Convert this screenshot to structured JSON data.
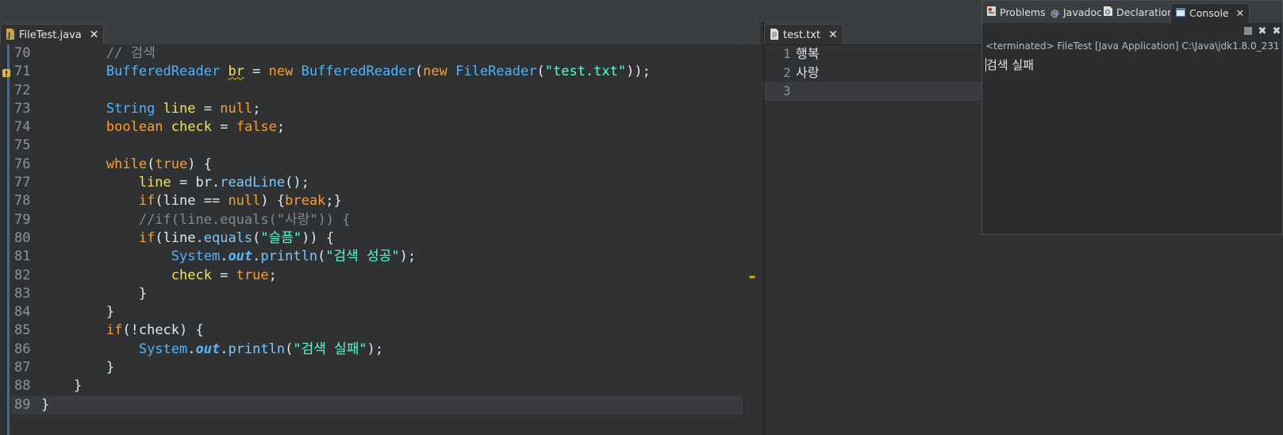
{
  "editor": {
    "tab": {
      "label": "FileTest.java",
      "close": "✕"
    },
    "lines": [
      {
        "n": "70",
        "tokens": [
          [
            "ws",
            "        "
          ],
          [
            "c-comment",
            "// 검색"
          ]
        ]
      },
      {
        "n": "71",
        "tokens": [
          [
            "ws",
            "        "
          ],
          [
            "c-type",
            "BufferedReader"
          ],
          [
            "c-plain",
            " "
          ],
          [
            "c-var squiggle",
            "br"
          ],
          [
            "c-plain",
            " = "
          ],
          [
            "c-kw",
            "new"
          ],
          [
            "c-plain",
            " "
          ],
          [
            "c-type",
            "BufferedReader"
          ],
          [
            "c-plain",
            "("
          ],
          [
            "c-kw",
            "new"
          ],
          [
            "c-plain",
            " "
          ],
          [
            "c-type",
            "FileReader"
          ],
          [
            "c-plain",
            "("
          ],
          [
            "c-str",
            "\"test.txt\""
          ],
          [
            "c-plain",
            "));"
          ]
        ]
      },
      {
        "n": "72",
        "tokens": []
      },
      {
        "n": "73",
        "tokens": [
          [
            "ws",
            "        "
          ],
          [
            "c-type",
            "String"
          ],
          [
            "c-plain",
            " "
          ],
          [
            "c-var",
            "line"
          ],
          [
            "c-plain",
            " = "
          ],
          [
            "c-kw",
            "null"
          ],
          [
            "c-plain",
            ";"
          ]
        ]
      },
      {
        "n": "74",
        "tokens": [
          [
            "ws",
            "        "
          ],
          [
            "c-kw",
            "boolean"
          ],
          [
            "c-plain",
            " "
          ],
          [
            "c-var",
            "check"
          ],
          [
            "c-plain",
            " = "
          ],
          [
            "c-kw",
            "false"
          ],
          [
            "c-plain",
            ";"
          ]
        ]
      },
      {
        "n": "75",
        "tokens": []
      },
      {
        "n": "76",
        "tokens": [
          [
            "ws",
            "        "
          ],
          [
            "c-kw",
            "while"
          ],
          [
            "c-plain",
            "("
          ],
          [
            "c-kw",
            "true"
          ],
          [
            "c-plain",
            ") {"
          ]
        ]
      },
      {
        "n": "77",
        "tokens": [
          [
            "ws",
            "            "
          ],
          [
            "c-var",
            "line"
          ],
          [
            "c-plain",
            " = br."
          ],
          [
            "c-method",
            "readLine"
          ],
          [
            "c-plain",
            "();"
          ]
        ]
      },
      {
        "n": "78",
        "tokens": [
          [
            "ws",
            "            "
          ],
          [
            "c-kw",
            "if"
          ],
          [
            "c-plain",
            "(line == "
          ],
          [
            "c-kw",
            "null"
          ],
          [
            "c-plain",
            ") {"
          ],
          [
            "c-kw",
            "break"
          ],
          [
            "c-plain",
            ";}"
          ]
        ]
      },
      {
        "n": "79",
        "tokens": [
          [
            "ws",
            "            "
          ],
          [
            "c-comment",
            "//if(line.equals(\"사랑\")) {"
          ]
        ]
      },
      {
        "n": "80",
        "tokens": [
          [
            "ws",
            "            "
          ],
          [
            "c-kw",
            "if"
          ],
          [
            "c-plain",
            "(line."
          ],
          [
            "c-method",
            "equals"
          ],
          [
            "c-plain",
            "("
          ],
          [
            "c-str",
            "\"슬픔\""
          ],
          [
            "c-plain",
            ")) {"
          ]
        ]
      },
      {
        "n": "81",
        "tokens": [
          [
            "ws",
            "                "
          ],
          [
            "c-type",
            "System"
          ],
          [
            "c-plain",
            "."
          ],
          [
            "c-field",
            "out"
          ],
          [
            "c-plain",
            "."
          ],
          [
            "c-method",
            "println"
          ],
          [
            "c-plain",
            "("
          ],
          [
            "c-str",
            "\"검색 성공\""
          ],
          [
            "c-plain",
            ");"
          ]
        ]
      },
      {
        "n": "82",
        "tokens": [
          [
            "ws",
            "                "
          ],
          [
            "c-var",
            "check"
          ],
          [
            "c-plain",
            " = "
          ],
          [
            "c-kw",
            "true"
          ],
          [
            "c-plain",
            ";"
          ]
        ]
      },
      {
        "n": "83",
        "tokens": [
          [
            "ws",
            "            "
          ],
          [
            "c-plain",
            "}"
          ]
        ]
      },
      {
        "n": "84",
        "tokens": [
          [
            "ws",
            "        "
          ],
          [
            "c-plain",
            "}"
          ]
        ]
      },
      {
        "n": "85",
        "tokens": [
          [
            "ws",
            "        "
          ],
          [
            "c-kw",
            "if"
          ],
          [
            "c-plain",
            "(!check) {"
          ]
        ]
      },
      {
        "n": "86",
        "tokens": [
          [
            "ws",
            "            "
          ],
          [
            "c-type",
            "System"
          ],
          [
            "c-plain",
            "."
          ],
          [
            "c-field",
            "out"
          ],
          [
            "c-plain",
            "."
          ],
          [
            "c-method",
            "println"
          ],
          [
            "c-plain",
            "("
          ],
          [
            "c-str",
            "\"검색 실패\""
          ],
          [
            "c-plain",
            ");"
          ]
        ]
      },
      {
        "n": "87",
        "tokens": [
          [
            "ws",
            "        "
          ],
          [
            "c-plain",
            "}"
          ]
        ]
      },
      {
        "n": "88",
        "tokens": [
          [
            "ws",
            "    "
          ],
          [
            "c-plain",
            "}"
          ]
        ]
      },
      {
        "n": "89",
        "tokens": [
          [
            "c-plain",
            "}"
          ]
        ]
      }
    ]
  },
  "textfile": {
    "tab": {
      "label": "test.txt",
      "close": "✕"
    },
    "lines": [
      {
        "n": "1",
        "text": "행복"
      },
      {
        "n": "2",
        "text": "사랑"
      },
      {
        "n": "3",
        "text": ""
      }
    ]
  },
  "views": {
    "tabs": [
      {
        "label": "Problems",
        "icon": "problems-icon"
      },
      {
        "label": "Javadoc",
        "icon": "javadoc-icon"
      },
      {
        "label": "Declaration",
        "icon": "declaration-icon"
      },
      {
        "label": "Console",
        "icon": "console-icon",
        "close": "✕"
      }
    ],
    "console": {
      "status": "<terminated> FileTest [Java Application] C:\\Java\\jdk1.8.0_231",
      "output": "검색 실패"
    }
  }
}
